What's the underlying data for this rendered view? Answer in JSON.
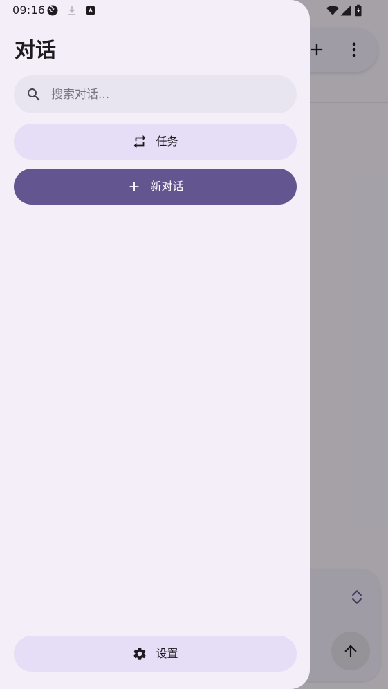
{
  "status_bar": {
    "time": "09:16",
    "icons": [
      "sync-icon",
      "download-icon",
      "keyboard-a-icon",
      "wifi-icon",
      "signal-icon",
      "battery-icon"
    ]
  },
  "drawer": {
    "title": "对话",
    "search": {
      "placeholder": "搜索对话...",
      "value": ""
    },
    "tasks_button": {
      "label": "任务",
      "icon": "repeat-icon"
    },
    "new_chat_button": {
      "label": "新对话",
      "icon": "plus-icon"
    },
    "settings_button": {
      "label": "设置",
      "icon": "gear-icon"
    }
  },
  "background_app": {
    "top_actions": [
      "add-icon",
      "more-vert-icon"
    ],
    "input_actions": [
      "expand-icon",
      "send-icon"
    ]
  },
  "colors": {
    "drawer_bg": "#f3eef8",
    "primary": "#635590",
    "secondary_container": "#e6def6",
    "scrim": "rgba(0,0,0,0.32)"
  }
}
